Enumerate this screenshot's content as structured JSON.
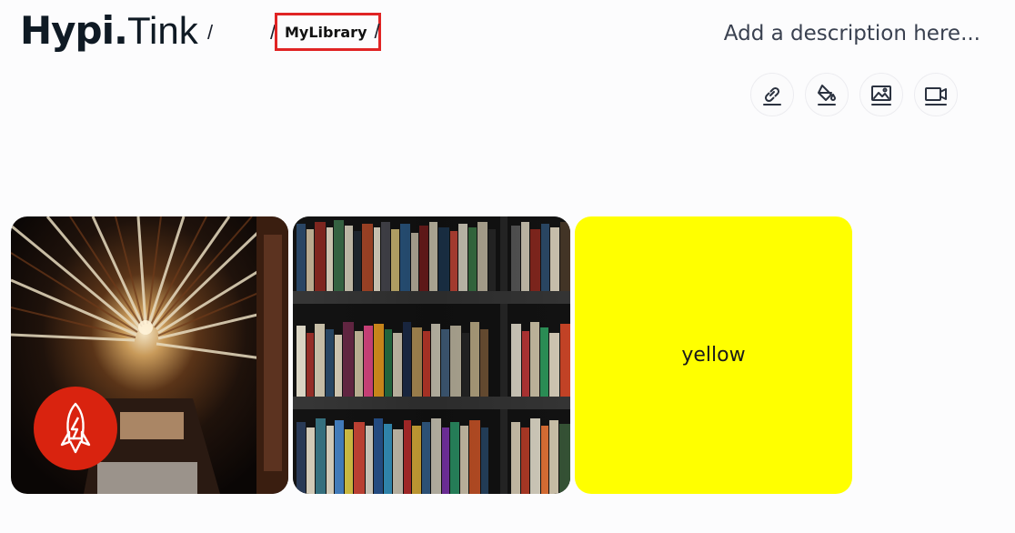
{
  "header": {
    "brand_bold": "Hypi.",
    "brand_light": "Tink",
    "sep1": "/",
    "sep2": "/",
    "breadcrumb_current": "MyLibrary",
    "sep3": "/",
    "description_placeholder": "Add a description here..."
  },
  "toolbar": {
    "buttons": [
      {
        "name": "link",
        "icon": "link-icon"
      },
      {
        "name": "fill",
        "icon": "paint-bucket-icon"
      },
      {
        "name": "image",
        "icon": "image-icon"
      },
      {
        "name": "video",
        "icon": "video-icon"
      }
    ]
  },
  "cards": [
    {
      "type": "image",
      "subject": "bookstore tunnel",
      "badge_icon": "rocket-icon",
      "badge_color": "#d9230f"
    },
    {
      "type": "image",
      "subject": "bookshelf"
    },
    {
      "type": "color",
      "color": "#ffff00",
      "label": "yellow"
    }
  ],
  "colors": {
    "highlight": "#e02424",
    "text": "#1a1f2b",
    "muted": "#3a4150"
  }
}
